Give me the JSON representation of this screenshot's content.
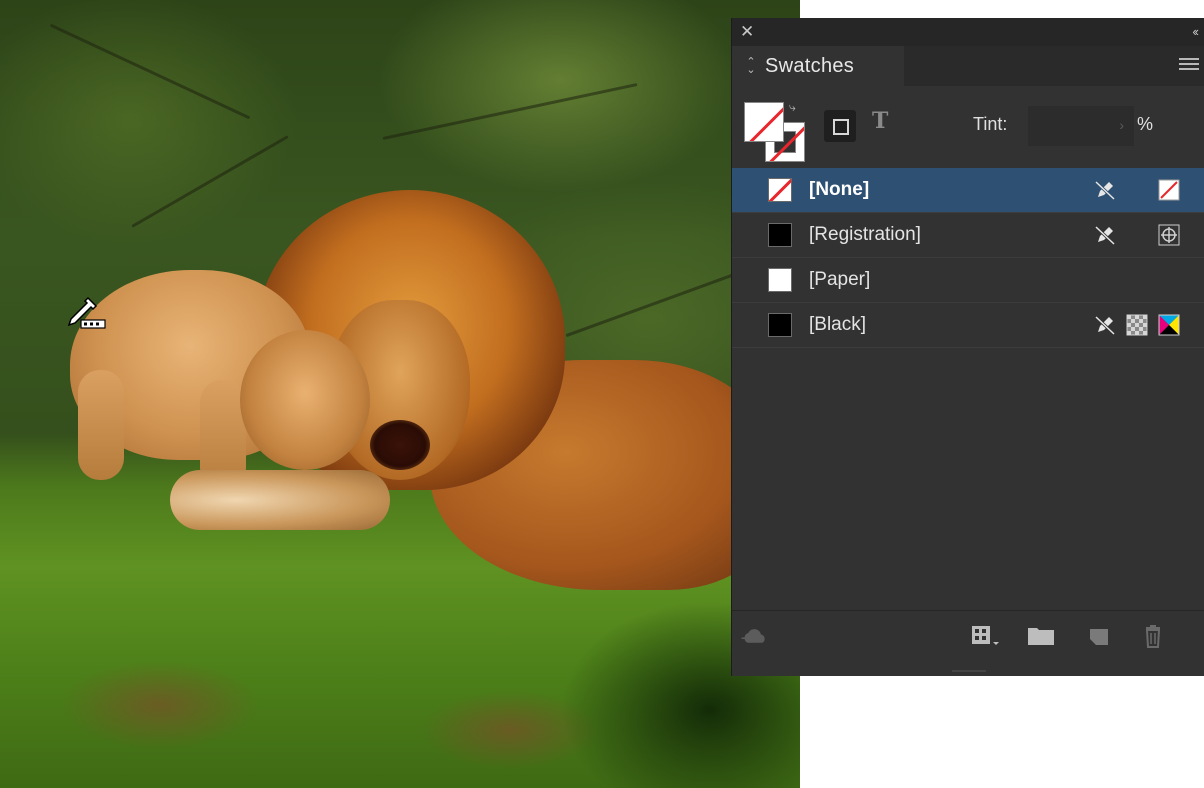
{
  "panel": {
    "title": "Swatches",
    "tint_label": "Tint:",
    "tint_value": "",
    "tint_unit": "%",
    "swatches": [
      {
        "name": "[None]",
        "selected": true,
        "chip": "none",
        "icons": [
          "pencil-no-edit-icon",
          "none-swatch-icon"
        ]
      },
      {
        "name": "[Registration]",
        "selected": false,
        "chip": "black",
        "icons": [
          "pencil-no-edit-icon",
          "registration-mark-icon"
        ]
      },
      {
        "name": "[Paper]",
        "selected": false,
        "chip": "white",
        "icons": []
      },
      {
        "name": "[Black]",
        "selected": false,
        "chip": "black",
        "icons": [
          "pencil-no-edit-icon",
          "process-color-icon",
          "cmyk-mode-icon"
        ]
      }
    ]
  },
  "colors": {
    "panel_bg": "#323232",
    "selection": "#2e5073",
    "none_red": "#e8262b"
  }
}
